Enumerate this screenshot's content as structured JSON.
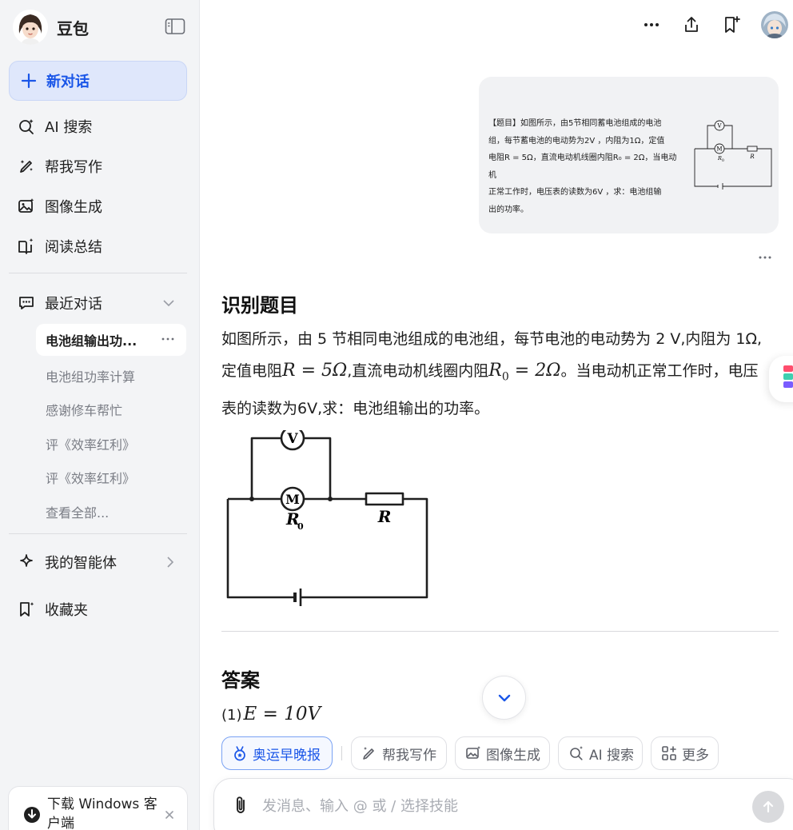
{
  "app": {
    "name": "豆包"
  },
  "sidebar": {
    "new_chat": "新对话",
    "nav": [
      {
        "label": "AI 搜索",
        "icon": "search-sparkle-icon"
      },
      {
        "label": "帮我写作",
        "icon": "pen-icon"
      },
      {
        "label": "图像生成",
        "icon": "image-icon"
      },
      {
        "label": "阅读总结",
        "icon": "book-icon"
      }
    ],
    "recent_title": "最近对话",
    "active_conversation": "电池组输出功...",
    "conversations": [
      "电池组功率计算",
      "感谢修车帮忙",
      "评《效率红利》",
      "评《效率红利》",
      "查看全部..."
    ],
    "my_agents": "我的智能体",
    "favorites": "收藏夹",
    "download": "下载 Windows 客户端"
  },
  "user_message": {
    "lines": [
      "【题目】如图所示，由5节相同蓄电池组成的电池",
      "组，每节蓄电池的电动势为2V ，内阻为1Ω，定值",
      "电阻R = 5Ω，直流电动机线圈内阻R₀ = 2Ω，当电动机",
      "正常工作时，电压表的读数为6V ，求：电池组输",
      "出的功率。"
    ]
  },
  "response": {
    "section1_title": "识别题目",
    "line1": "如图所示，由 5 节相同电池组成的电池组，每节电池的电动势为 2 V,内阻为 1Ω,",
    "line2_a": "定值电阻",
    "line2_m1": "R = 5Ω",
    "line2_b": ",直流电动机线圈内阻",
    "line2_m2": "R",
    "line2_m2_sub": "0",
    "line2_m2_rest": " = 2Ω",
    "line2_c": "。当电动机正常工作时，电压",
    "line3": "表的读数为6V,求：电池组输出的功率。",
    "section2_title": "答案",
    "answer_prefix": "(1)",
    "answer_math": "E = 10V"
  },
  "circuit_labels": {
    "voltmeter": "V",
    "motor": "M",
    "motor_resistance": "R",
    "motor_resistance_sub": "0",
    "resistor": "R"
  },
  "skills": [
    {
      "label": "奥运早晚报",
      "icon": "medal-icon",
      "active": true
    },
    {
      "label": "帮我写作",
      "icon": "pen-icon"
    },
    {
      "label": "图像生成",
      "icon": "image-icon"
    },
    {
      "label": "AI 搜索",
      "icon": "search-sparkle-icon"
    },
    {
      "label": "更多",
      "icon": "grid-plus-icon"
    }
  ],
  "composer": {
    "placeholder": "发消息、输入 @ 或 / 选择技能"
  },
  "colors": {
    "accent": "#1a56e8",
    "sidebar_bg": "#f3f4f6",
    "bubble_bg": "#f1f2f4"
  }
}
